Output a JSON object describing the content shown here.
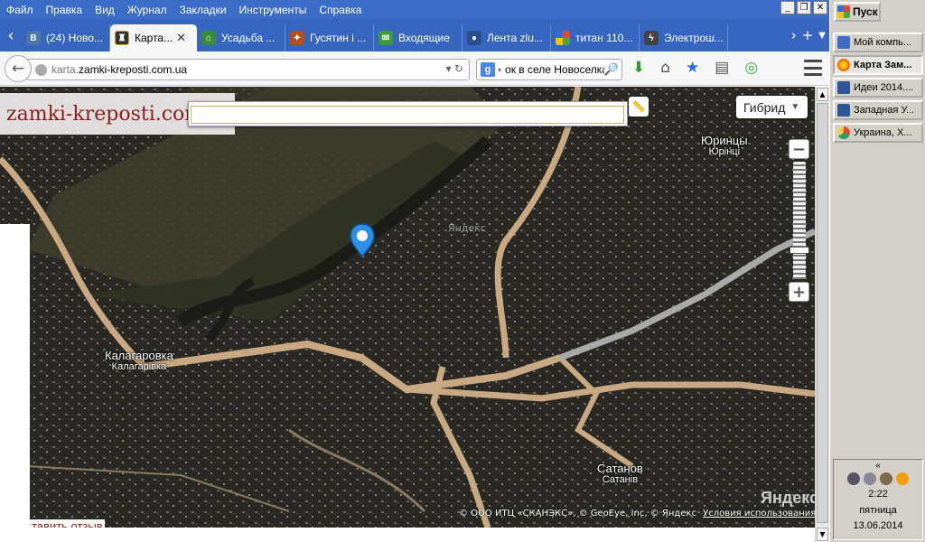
{
  "menubar": {
    "items": [
      "Файл",
      "Правка",
      "Вид",
      "Журнал",
      "Закладки",
      "Инструменты",
      "Справка"
    ]
  },
  "window_controls": {
    "minimize": "_",
    "restore": "❐",
    "close": "✕"
  },
  "tabs": [
    {
      "label": "(24) Ново...",
      "icon": "vk-icon",
      "color": "#4a76a8",
      "active": false
    },
    {
      "label": "Карта...",
      "icon": "castle-site-icon",
      "color": "#333",
      "active": true
    },
    {
      "label": "Усадьба ...",
      "icon": "building-icon",
      "color": "#3a8c3a",
      "active": false
    },
    {
      "label": "Гусятин і ...",
      "icon": "picture-icon",
      "color": "#b05020",
      "active": false
    },
    {
      "label": "Входящие",
      "icon": "mail-icon",
      "color": "#3c9a3c",
      "active": false
    },
    {
      "label": "Лента zlu...",
      "icon": "user-icon",
      "color": "#2a4f8f",
      "active": false
    },
    {
      "label": "титан 110...",
      "icon": "windows-icon",
      "color": "#e8a020",
      "active": false
    },
    {
      "label": "Электрош...",
      "icon": "tool-icon",
      "color": "#444",
      "active": false
    }
  ],
  "toolbar": {
    "url_prefix": "karta.",
    "url_domain": "zamki-kreposti.com.ua",
    "search_text": "ок в селе Новоселка",
    "search_engine_badge": "g"
  },
  "site": {
    "logo_text": "zamki-kreposti.com.ua",
    "feedback_link": "тавить отзыв"
  },
  "map": {
    "layer_button": "Гибрид",
    "watermark": "Яндекс",
    "logo": "Яндекс",
    "copyright": "© ООО ИТЦ «СКАНЭКС», © GeoEye, Inc, © Яндекс",
    "terms_link": "Условия использования",
    "zoom_in": "+",
    "zoom_out": "−",
    "places": [
      {
        "name_ru": "Юринцы",
        "name_ua": "Юрінці"
      },
      {
        "name_ru": "Калагаровка",
        "name_ua": "Калагарівка"
      },
      {
        "name_ru": "Сатанов",
        "name_ua": "Сатанів"
      }
    ]
  },
  "taskbar": {
    "start_label": "Пуск",
    "items": [
      {
        "label": "Мой компь...",
        "color": "#3b6cc6",
        "active": false
      },
      {
        "label": "Карта Зам...",
        "color": "#e66000",
        "active": true
      },
      {
        "label": "Идеи 2014....",
        "color": "#2b579a",
        "active": false
      },
      {
        "label": "Западная У...",
        "color": "#2b579a",
        "active": false
      },
      {
        "label": "Украина, Х...",
        "color": "#dd4b39",
        "active": false
      }
    ],
    "tray": {
      "chevron": "«",
      "time": "2:22",
      "day": "пятница",
      "date": "13.06.2014"
    }
  }
}
